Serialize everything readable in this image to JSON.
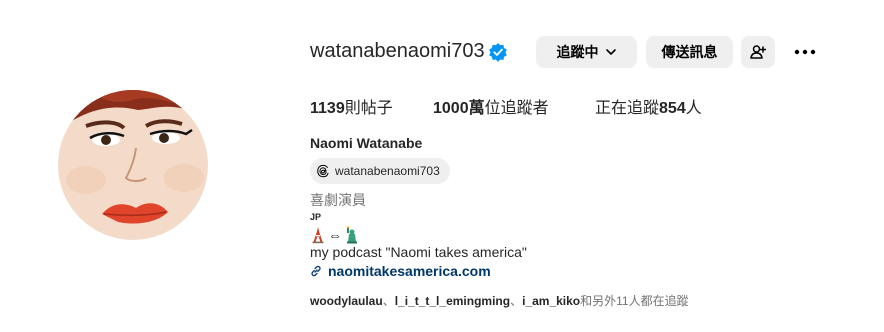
{
  "profile": {
    "username": "watanabenaomi703",
    "verified": true,
    "buttons": {
      "following_label": "追蹤中",
      "message_label": "傳送訊息"
    },
    "stats": {
      "posts_count": "1139",
      "posts_label": "則帖子",
      "followers_count": "1000萬",
      "followers_label": "位追蹤者",
      "following_prefix": "正在追蹤",
      "following_count": "854",
      "following_suffix": "人"
    },
    "full_name": "Naomi Watanabe",
    "threads_handle": "watanabenaomi703",
    "category": "喜劇演員",
    "bio": {
      "country": "JP",
      "arrow": "⇔",
      "text": "my podcast \"Naomi takes america\"",
      "link": "naomitakesamerica.com"
    },
    "followed_by": {
      "user1": "woodylaulau",
      "sep1": "、",
      "user2": "l_i_t_t_l_emingming",
      "sep2": "、",
      "user3": "i_am_kiko",
      "suffix": "和另外11人都在追蹤"
    }
  },
  "icons": {
    "verified": "verified-badge-icon",
    "chevron": "chevron-down-icon",
    "add_user": "add-user-icon",
    "more": "more-options-icon",
    "threads": "threads-icon",
    "link": "link-icon",
    "tower": "tokyo-tower-icon",
    "statue": "statue-of-liberty-icon"
  },
  "colors": {
    "verified": "#0095f6",
    "link": "#00376b",
    "button_bg": "#efefef",
    "secondary_text": "#737373"
  }
}
